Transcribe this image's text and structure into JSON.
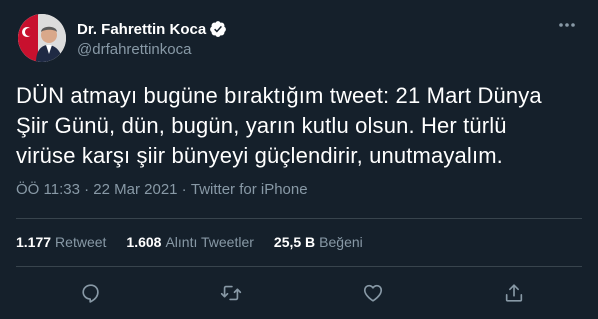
{
  "tweet": {
    "author": {
      "display_name": "Dr. Fahrettin Koca",
      "handle": "@drfahrettinkoca",
      "verified": true
    },
    "text": "DÜN atmayı bugüne bıraktığım tweet: 21 Mart Dünya\nŞiir Günü, dün, bugün, yarın kutlu olsun. Her türlü\nvirüse karşı şiir bünyeyi güçlendirir, unutmayalım.",
    "time": "ÖÖ 11:33",
    "separator": " · ",
    "date": "22 Mar 2021",
    "source": "Twitter for iPhone"
  },
  "stats": {
    "retweets": {
      "count": "1.177",
      "label": "Retweet"
    },
    "quotes": {
      "count": "1.608",
      "label": "Alıntı Tweetler"
    },
    "likes": {
      "count": "25,5 B",
      "label": "Beğeni"
    }
  },
  "actions": [
    "reply-icon",
    "retweet-icon",
    "like-icon",
    "share-icon"
  ],
  "colors": {
    "background": "#15202b",
    "text": "#ffffff",
    "secondary": "#8899a6",
    "divider": "#38444d",
    "verified": "#ffffff"
  }
}
